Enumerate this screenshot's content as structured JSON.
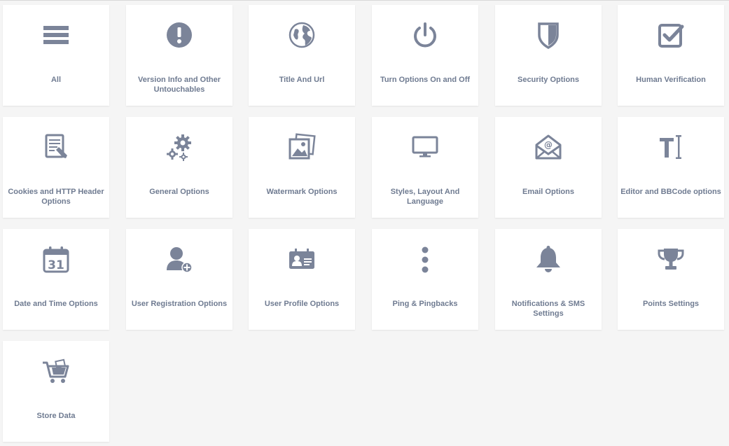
{
  "colors": {
    "icon": "#7b8499",
    "label": "#6f7b91",
    "background": "#f5f5f5",
    "tile": "#ffffff"
  },
  "tiles": [
    {
      "label": "All",
      "icon": "list-icon"
    },
    {
      "label": "Version Info and Other Untouchables",
      "icon": "exclamation-circle-icon"
    },
    {
      "label": "Title And Url",
      "icon": "globe-icon"
    },
    {
      "label": "Turn Options On and Off",
      "icon": "power-icon"
    },
    {
      "label": "Security Options",
      "icon": "shield-icon"
    },
    {
      "label": "Human Verification",
      "icon": "checkbox-icon"
    },
    {
      "label": "Cookies and HTTP Header Options",
      "icon": "document-edit-icon"
    },
    {
      "label": "General Options",
      "icon": "gears-icon"
    },
    {
      "label": "Watermark Options",
      "icon": "pictures-icon"
    },
    {
      "label": "Styles, Layout And Language",
      "icon": "monitor-icon"
    },
    {
      "label": "Email Options",
      "icon": "envelope-at-icon"
    },
    {
      "label": "Editor and BBCode options",
      "icon": "text-cursor-icon"
    },
    {
      "label": "Date and Time Options",
      "icon": "calendar-icon"
    },
    {
      "label": "User Registration Options",
      "icon": "user-plus-icon"
    },
    {
      "label": "User Profile Options",
      "icon": "id-card-icon"
    },
    {
      "label": "Ping & Pingbacks",
      "icon": "vertical-dots-icon"
    },
    {
      "label": "Notifications & SMS Settings",
      "icon": "bell-icon"
    },
    {
      "label": "Points Settings",
      "icon": "trophy-icon"
    },
    {
      "label": "Store Data",
      "icon": "cart-icon"
    }
  ],
  "calendar_day": "31"
}
